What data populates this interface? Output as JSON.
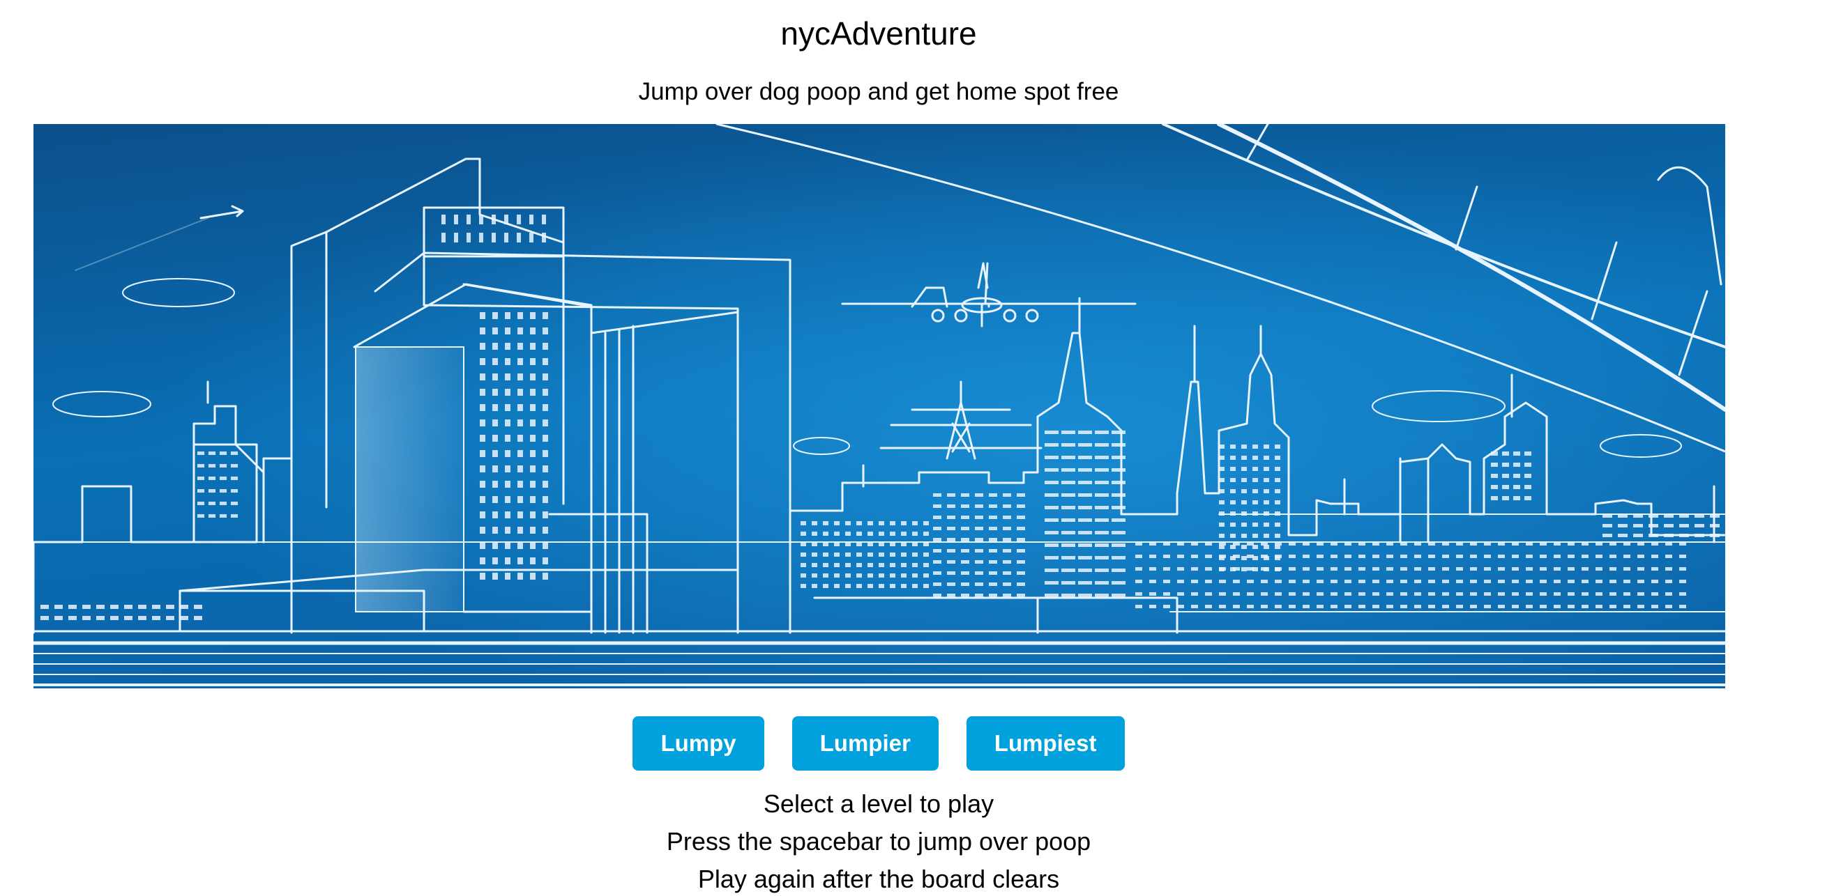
{
  "header": {
    "title": "nycAdventure",
    "subtitle": "Jump over dog poop and get home spot free"
  },
  "board": {
    "scene": "city-skyline-illustration",
    "colors": {
      "sky_top": "#0b4f8a",
      "sky_mid": "#0a6fb5",
      "sky_glow": "#1a8fd6",
      "line": "#e8f4ff"
    }
  },
  "levels": {
    "buttons": [
      "Lumpy",
      "Lumpier",
      "Lumpiest"
    ],
    "button_color": "#00a1dc",
    "button_text_color": "#ffffff"
  },
  "instructions": [
    "Select a level to play",
    "Press the spacebar to jump over poop",
    "Play again after the board clears"
  ]
}
